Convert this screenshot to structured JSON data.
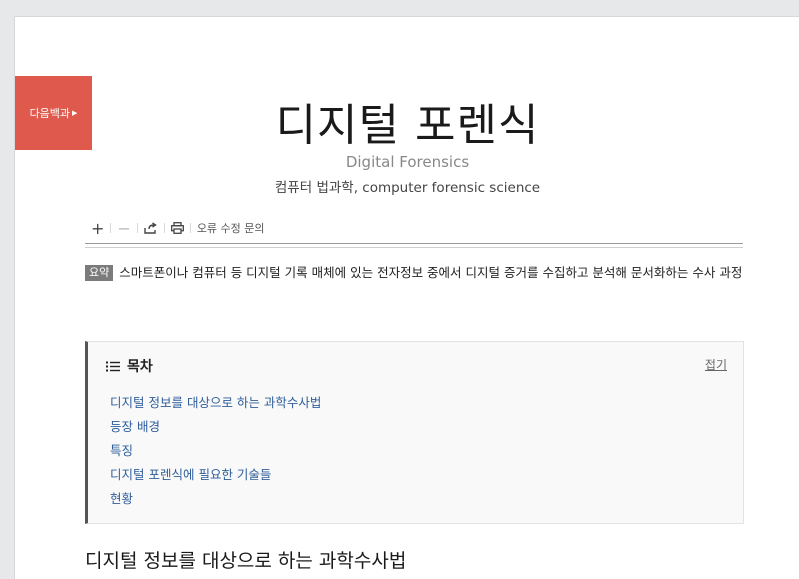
{
  "badge": {
    "label": "다음백과"
  },
  "header": {
    "title": "디지털 포렌식",
    "subtitle_en": "Digital Forensics",
    "subtitle_ko": "컴퓨터 법과학, computer forensic science"
  },
  "toolbar": {
    "zoom_in": "+",
    "zoom_out": "−",
    "report_label": "오류 수정 문의"
  },
  "summary": {
    "tag": "요약",
    "text": "스마트폰이나 컴퓨터 등 디지털 기록 매체에 있는 전자정보 중에서 디지털 증거를 수집하고 분석해 문서화하는 수사 과정"
  },
  "toc": {
    "title": "목차",
    "fold_label": "접기",
    "items": [
      {
        "label": "디지털 정보를 대상으로 하는 과학수사법"
      },
      {
        "label": "등장 배경"
      },
      {
        "label": "특징"
      },
      {
        "label": "디지털 포렌식에 필요한 기술들"
      },
      {
        "label": "현황"
      }
    ]
  },
  "section": {
    "heading": "디지털 정보를 대상으로 하는 과학수사법"
  },
  "colors": {
    "badge": "#df5a4c",
    "toc_link": "#2f5e9b",
    "toc_border": "#555555"
  }
}
